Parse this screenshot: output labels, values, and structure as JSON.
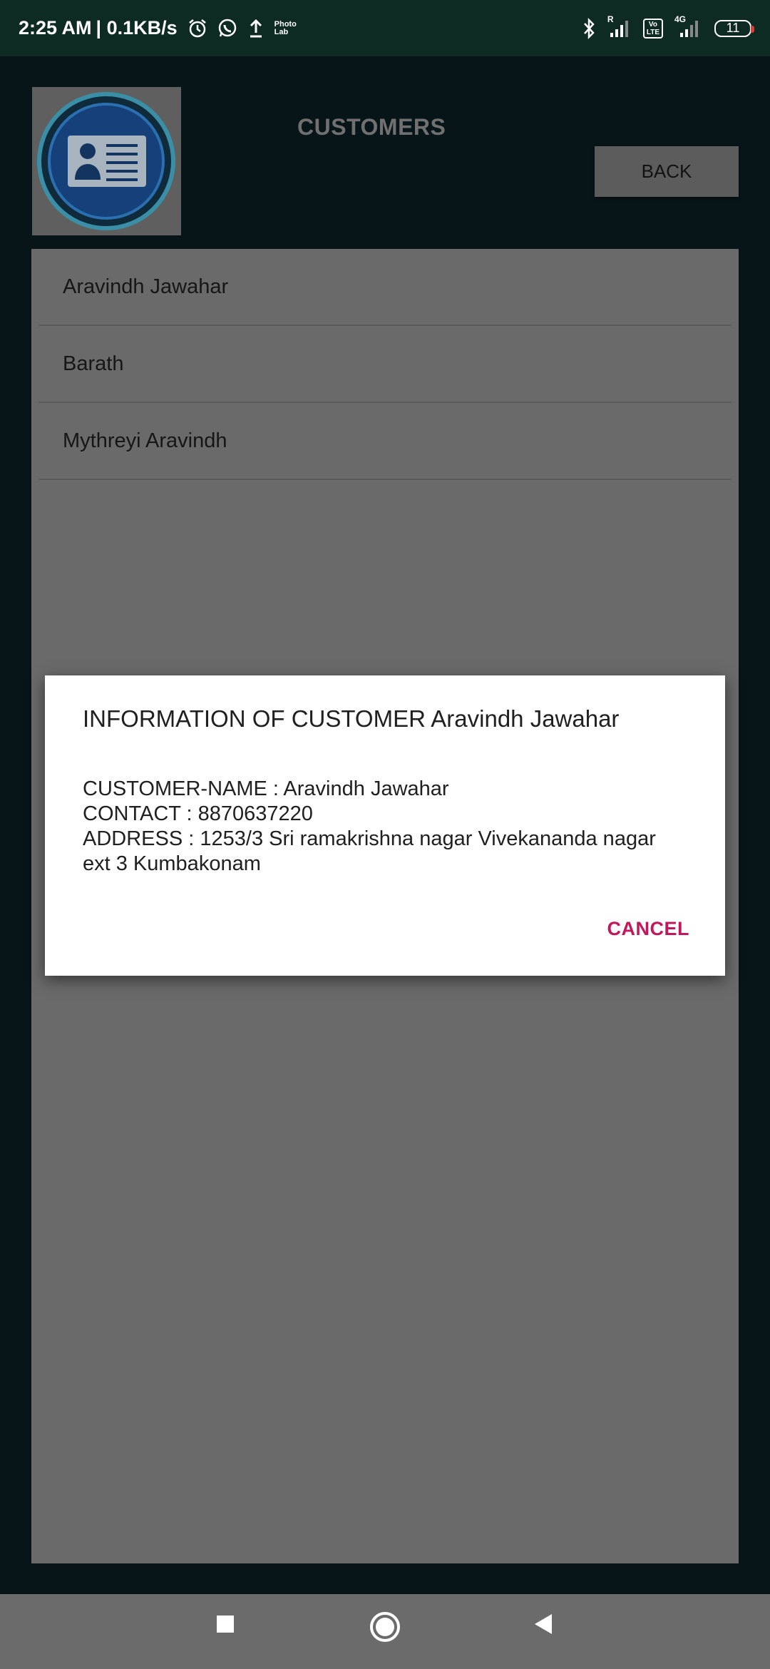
{
  "status_bar": {
    "time": "2:25 AM",
    "speed": "| 0.1KB/s",
    "photo_lab": "Photo\nLab",
    "volte": "Vo\nLTE",
    "network": "4G",
    "roaming": "R",
    "battery": "11"
  },
  "header": {
    "title": "CUSTOMERS",
    "back_label": "BACK"
  },
  "customers": [
    {
      "name": "Aravindh Jawahar"
    },
    {
      "name": "Barath"
    },
    {
      "name": "Mythreyi Aravindh"
    }
  ],
  "dialog": {
    "title": "INFORMATION OF CUSTOMER Aravindh Jawahar",
    "name_line": "CUSTOMER-NAME : Aravindh Jawahar",
    "contact_line": "CONTACT : 8870637220",
    "address_line": "ADDRESS : 1253/3 Sri ramakrishna nagar Vivekananda nagar ext 3 Kumbakonam",
    "cancel_label": "CANCEL"
  },
  "colors": {
    "status_bar": "#0d2b22",
    "accent": "#c2185b",
    "overlay_panel": "#6a6a6a"
  },
  "icons": {
    "logo": "contact-card-icon",
    "nav_recent": "square-icon",
    "nav_home": "circle-icon",
    "nav_back": "triangle-back-icon"
  }
}
